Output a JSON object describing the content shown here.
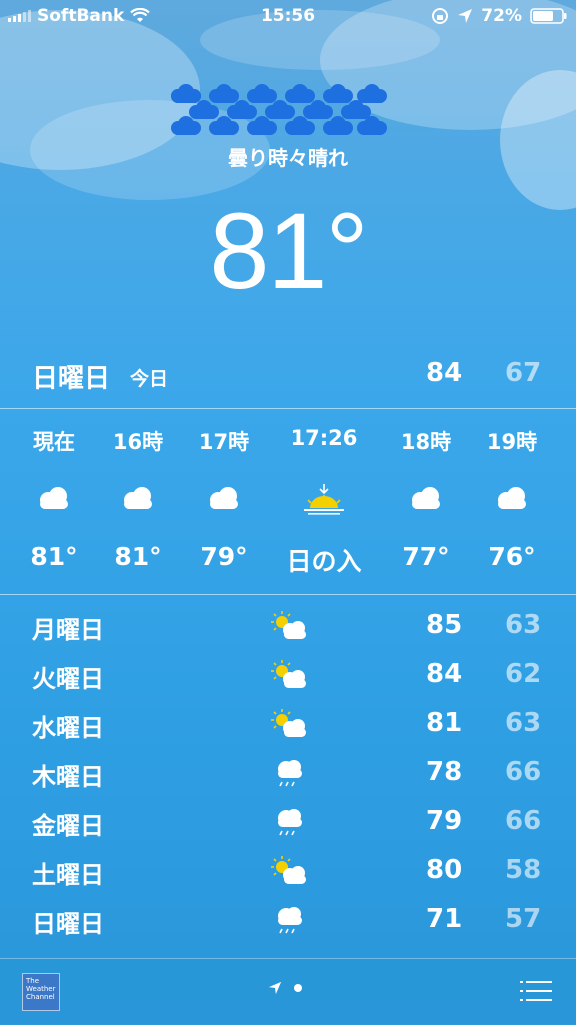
{
  "status_bar": {
    "carrier": "SoftBank",
    "time": "15:56",
    "battery": "72%",
    "icons": [
      "signal-bars-icon",
      "wifi-icon",
      "orientation-lock-icon",
      "location-arrow-icon",
      "battery-icon"
    ]
  },
  "current": {
    "condition": "曇り時々晴れ",
    "temperature": "81°"
  },
  "today": {
    "day": "日曜日",
    "label": "今日",
    "high": "84",
    "low": "67"
  },
  "hourly": [
    {
      "time": "現在",
      "icon": "cloud-icon",
      "value": "81°"
    },
    {
      "time": "16時",
      "icon": "cloud-icon",
      "value": "81°"
    },
    {
      "time": "17時",
      "icon": "cloud-icon",
      "value": "79°"
    },
    {
      "time": "17:26",
      "icon": "sunset-icon",
      "value": "日の入"
    },
    {
      "time": "18時",
      "icon": "cloud-icon",
      "value": "77°"
    },
    {
      "time": "19時",
      "icon": "cloud-icon",
      "value": "76°"
    }
  ],
  "daily": [
    {
      "day": "月曜日",
      "icon": "partly-sunny-icon",
      "high": "85",
      "low": "63"
    },
    {
      "day": "火曜日",
      "icon": "partly-sunny-icon",
      "high": "84",
      "low": "62"
    },
    {
      "day": "水曜日",
      "icon": "partly-sunny-icon",
      "high": "81",
      "low": "63"
    },
    {
      "day": "木曜日",
      "icon": "rain-icon",
      "high": "78",
      "low": "66"
    },
    {
      "day": "金曜日",
      "icon": "rain-icon",
      "high": "79",
      "low": "66"
    },
    {
      "day": "土曜日",
      "icon": "partly-sunny-icon",
      "high": "80",
      "low": "58"
    },
    {
      "day": "日曜日",
      "icon": "rain-icon",
      "high": "71",
      "low": "57"
    }
  ],
  "footer": {
    "logo_text": "The Weather Channel",
    "icons": [
      "weather-channel-logo",
      "location-arrow-icon",
      "page-dot",
      "list-icon"
    ]
  },
  "colors": {
    "sky_top": "#5fa9dd",
    "sky_bottom": "#2a96da",
    "low_temp": "rgba(255,255,255,0.6)",
    "sun": "#f5d000"
  }
}
